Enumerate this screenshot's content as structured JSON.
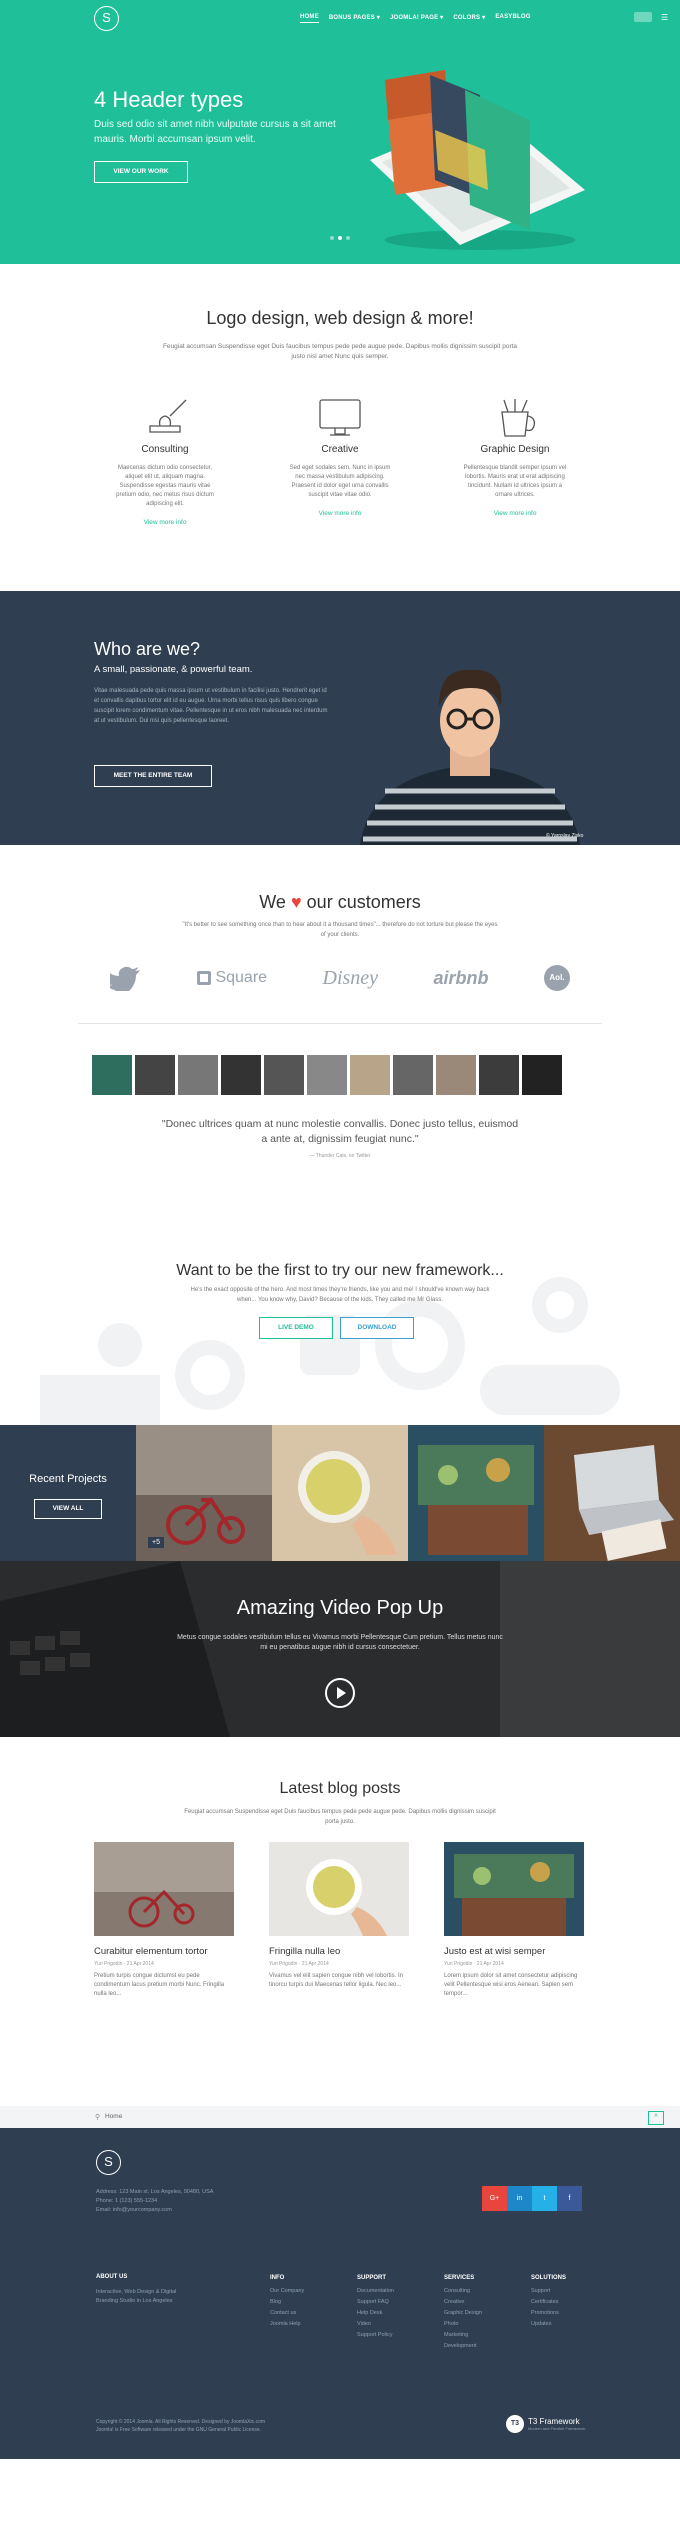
{
  "nav": {
    "logo": "S",
    "items": [
      "HOME",
      "BONUS PAGES ▾",
      "JOOMLA! PAGE ▾",
      "COLORS ▾",
      "EASYBLOG"
    ],
    "menu_icon": "hamburger-icon"
  },
  "hero": {
    "title": "4 Header types",
    "text": "Duis sed odio sit amet nibh vulputate cursus a sit amet mauris. Morbi accumsan ipsum velit.",
    "button": "VIEW OUR WORK",
    "slide_count": 3,
    "active_slide": 1
  },
  "services": {
    "title": "Logo design, web design & more!",
    "subtitle": "Feugiat accumsan Suspendisse eget Duis faucibus tempus pede pede augue pede. Dapibus mollis dignissim suscipit porta justo nisl amet Nunc quis semper.",
    "items": [
      {
        "icon": "stamp-icon",
        "title": "Consulting",
        "text": "Maecenas dictum odio consectetur, aliquet elit ut, aliquam magna. Suspendisse egestas mauris vitae pretium odio, nec metus risus dictum adipiscing elit.",
        "link": "View more info"
      },
      {
        "icon": "monitor-icon",
        "title": "Creative",
        "text": "Sed eget sodales sem. Nunc in ipsum nec massa vestibulum adipiscing. Praesent id dolor eget urna convallis suscipit vitae vitae odio.",
        "link": "View more info"
      },
      {
        "icon": "pencil-cup-icon",
        "title": "Graphic Design",
        "text": "Pellentesque blandit semper ipsum vel lobortis. Mauris erat ut erat adipiscing tincidunt. Nullam id ultrices ipsum a ornare ultrices.",
        "link": "View more info"
      }
    ]
  },
  "who": {
    "title": "Who are we?",
    "subtitle": "A small, passionate, & powerful team.",
    "text": "Vitae malesuada pede quis massa ipsum ut vestibulum in facilisi justo. Hendrerit eget id et convallis dapibus tortor elit id eu augue. Urna morbi tellus risus quis libero congue suscipit lorem condimentum vitae. Pellentesque in ut eros nibh malesuada nec interdum at ut vestibulum. Dui nisi quis pellentesque laoreet.",
    "button": "MEET THE ENTIRE TEAM",
    "credit": "© Yaroslav Zisko"
  },
  "customers": {
    "title_pre": "We",
    "title_post": "our customers",
    "quote": "\"It's better to see something once than to hear about it a thousand times\"... therefore do not torture but please the eyes of your clients.",
    "logos": [
      "twitter-logo",
      "Square",
      "Disney",
      "airbnb",
      "Aol."
    ],
    "testimonial": "\"Donec ultrices quam at nunc molestie convallis. Donec justo tellus, euismod a ante at, dignissim feugiat nunc.\"",
    "testimonial_author": "— Thunder Cats, on Twitter"
  },
  "framework": {
    "title": "Want to be the first to try our new framework...",
    "text": "He's the exact opposite of the hero. And most times they're friends, like you and me! I should've known way back when... You know why, David? Because of the kids. They called me Mr Glass.",
    "btn1": "LIVE DEMO",
    "btn2": "DOWNLOAD"
  },
  "projects": {
    "title": "Recent Projects",
    "button": "VIEW ALL",
    "badge": "+5"
  },
  "video": {
    "title": "Amazing Video Pop Up",
    "text": "Metus congue sodales vestibulum tellus eu Vivamus morbi Pellentesque Cum pretium. Tellus metus nunc mi eu penatibus augue nibh id cursus consectetuer."
  },
  "blog": {
    "title": "Latest blog posts",
    "subtitle": "Feugiat accumsan Suspendisse eget Duis faucibus tempus pede pede augue pede. Dapibus mollis dignissim suscipit porta justo.",
    "posts": [
      {
        "title": "Curabitur elementum tortor",
        "meta": "Yuri Prigodin · 21 Apr 2014",
        "text": "Pretium turpis congue dictumst eu pede condimentum lacus pretium morbi Nunc. Fringilla nulla leo..."
      },
      {
        "title": "Fringilla nulla leo",
        "meta": "Yuri Prigodin · 21 Apr 2014",
        "text": "Vivamus vel elit sapien congue nibh vel lobortis. In tinorcu turpis dui Maecenas tellor ligula. Nec leo..."
      },
      {
        "title": "Justo est at wisi semper",
        "meta": "Yuri Prigodin · 21 Apr 2014",
        "text": "Lorem ipsum dolor sit amet consectetur adipiscing velit Pellentesque wisi eros Aenean. Sapien sem tempor..."
      }
    ]
  },
  "breadcrumb": {
    "label": "Home"
  },
  "footer": {
    "logo": "S",
    "address": "Address: 123 Main st, Los Angeles, 90480, USA",
    "phone": "Phone: 1 (123) 555-1234",
    "email": "Email: info@yourcompany.com",
    "social": [
      "G+",
      "in",
      "t",
      "f"
    ],
    "about_title": "ABOUT US",
    "about_text": "Interactive, Web Design & Digital Branding Studio in Los Angeles",
    "columns": [
      {
        "title": "INFO",
        "items": [
          "Our Company",
          "Blog",
          "Contact us",
          "Joomla Help"
        ]
      },
      {
        "title": "SUPPORT",
        "items": [
          "Documentation",
          "Support FAQ",
          "Help Desk",
          "Video",
          "Support Policy"
        ]
      },
      {
        "title": "SERVICES",
        "items": [
          "Consulting",
          "Creative",
          "Graphic Design",
          "Photo",
          "Marketing",
          "Development"
        ]
      },
      {
        "title": "SOLUTIONS",
        "items": [
          "Support",
          "Certificates",
          "Promotions",
          "Updates"
        ]
      }
    ],
    "copyright": "Copyright © 2014 Joomla. All Rights Reserved. Designed by JoomlaXtc.com",
    "license": "Joomla! is Free Software released under the GNU General Public License.",
    "brand": "T3 Framework",
    "brand_sub": "Modern and Flexible Framework"
  },
  "colors": {
    "accent": "#1fbf99",
    "dark": "#2f3e50",
    "heart": "#e8453c"
  }
}
